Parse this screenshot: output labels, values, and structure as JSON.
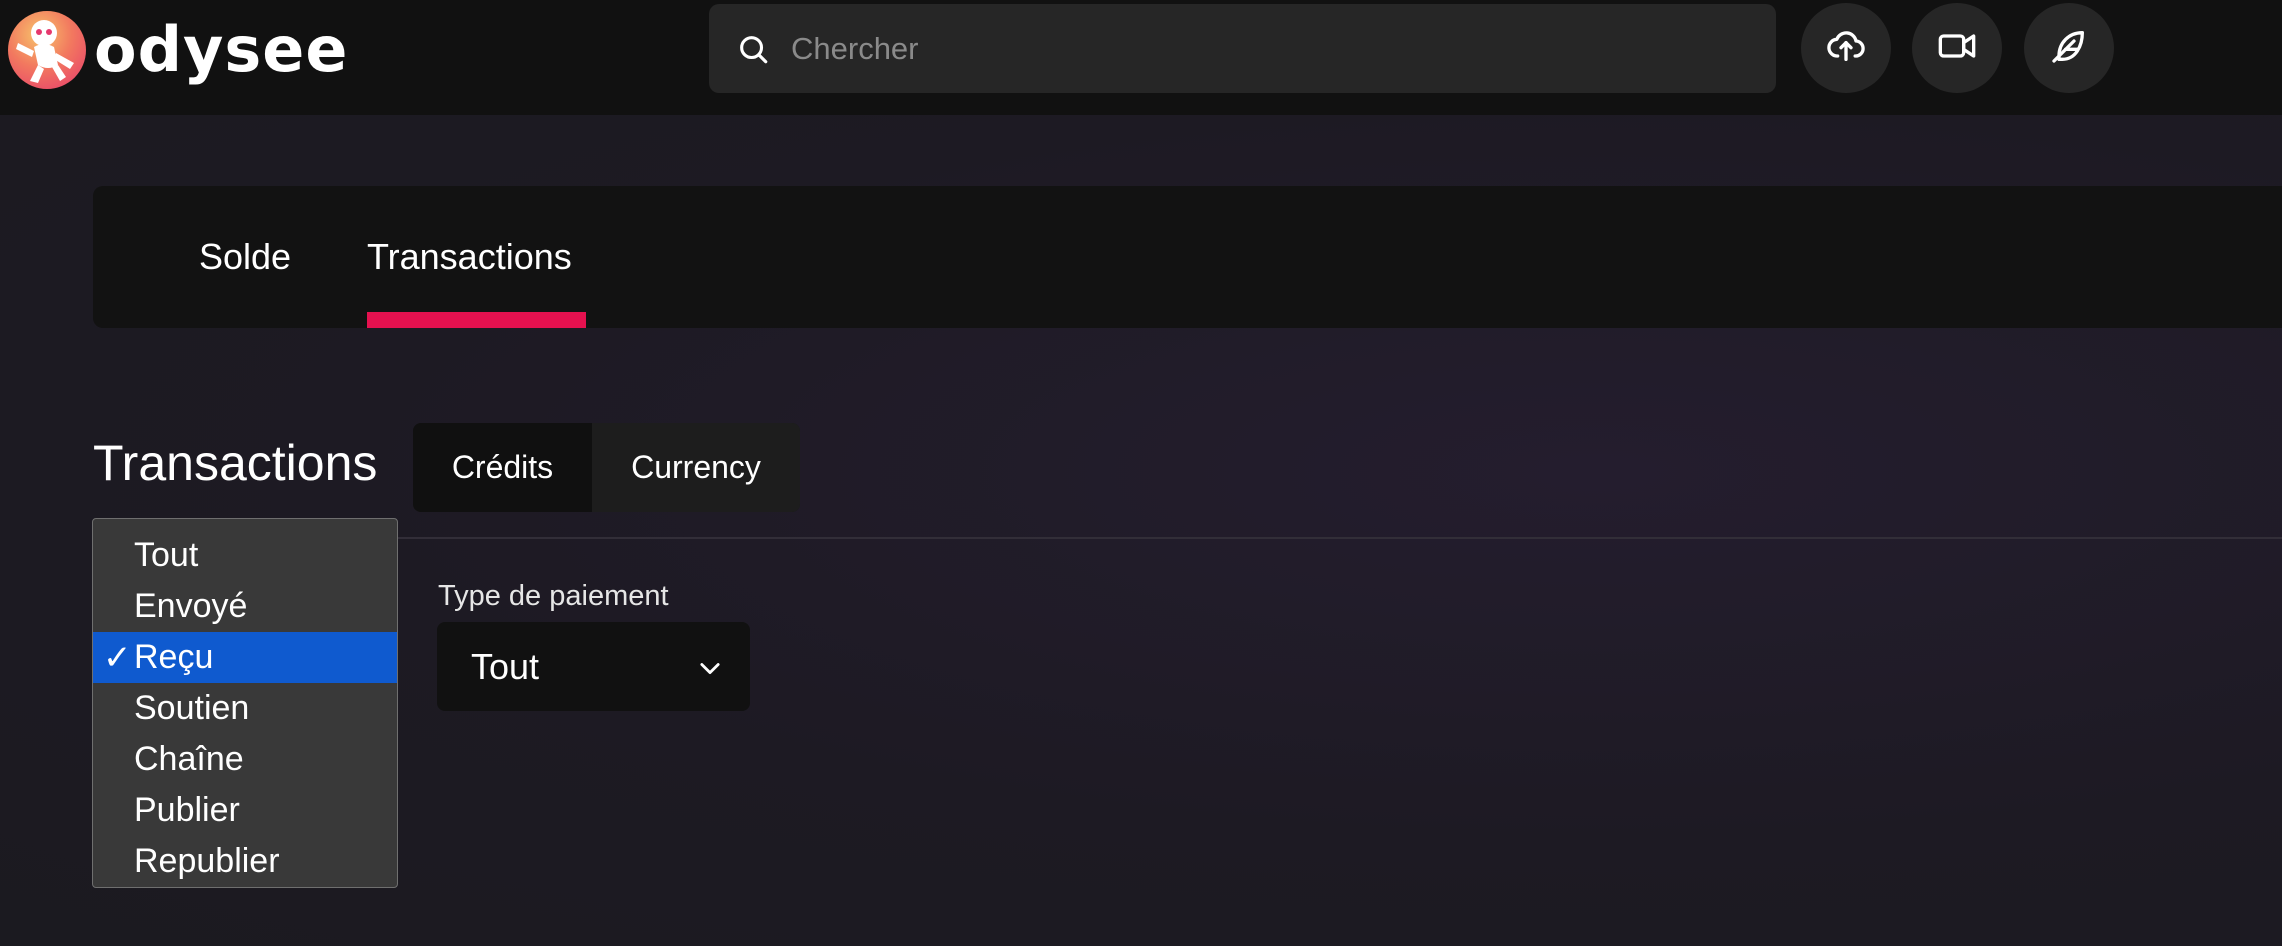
{
  "header": {
    "logo_text": "odysee",
    "search_placeholder": "Chercher",
    "icons": [
      "upload-icon",
      "video-icon",
      "feather-icon"
    ]
  },
  "tabs": [
    {
      "label": "Solde",
      "active": false
    },
    {
      "label": "Transactions",
      "active": true
    }
  ],
  "section": {
    "title": "Transactions",
    "segments": [
      {
        "label": "Crédits",
        "active": true
      },
      {
        "label": "Currency",
        "active": false
      }
    ]
  },
  "filter_dropdown": {
    "options": [
      "Tout",
      "Envoyé",
      "Reçu",
      "Soutien",
      "Chaîne",
      "Publier",
      "Republier"
    ],
    "selected": "Reçu",
    "check_mark": "✓"
  },
  "payment_type": {
    "label": "Type de paiement",
    "value": "Tout"
  },
  "colors": {
    "accent": "#e5114f",
    "selected_option": "#0f5acf",
    "header_bg": "#111111"
  }
}
